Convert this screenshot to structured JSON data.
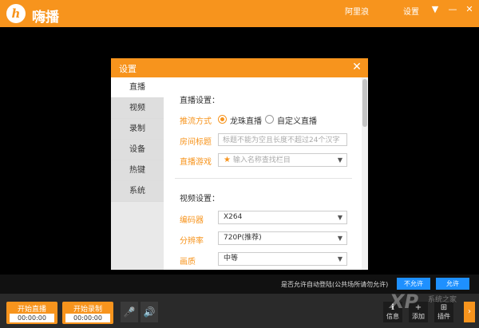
{
  "app": {
    "logo_letter": "h",
    "name": "嗨播"
  },
  "topbar": {
    "user": "阿里浪",
    "settings": "设置",
    "menu_icon": "▼",
    "min_icon": "—",
    "close_icon": "✕"
  },
  "dialog": {
    "title": "设置",
    "close_icon": "✕",
    "nav": [
      "直播",
      "视频",
      "录制",
      "设备",
      "热键",
      "系统"
    ],
    "live_section": "直播设置：",
    "push_label": "推流方式",
    "push_opt1": "龙珠直播",
    "push_opt2": "自定义直播",
    "room_label": "房间标题",
    "room_placeholder": "标题不能为空且长度不超过24个汉字",
    "game_label": "直播游戏",
    "game_placeholder": "输入名称查找栏目",
    "video_section": "视频设置：",
    "encoder_label": "编码器",
    "encoder_value": "X264",
    "res_label": "分辨率",
    "res_value": "720P(推荐)",
    "quality_label": "画质",
    "quality_value": "中等",
    "arrow": "▼"
  },
  "allow": {
    "text": "是否允许自动登陆(公共场所请勿允许)",
    "deny": "不允许",
    "allow": "允许"
  },
  "bottom": {
    "start_live": "开始直播",
    "live_time": "00:00:00",
    "start_record": "开始录制",
    "record_time": "00:00:00",
    "mic_icon": "🎤",
    "speaker_icon": "🔊",
    "tools": [
      {
        "icon": "ℹ",
        "label": "信息"
      },
      {
        "icon": "+",
        "label": "添加"
      },
      {
        "icon": "⊞",
        "label": "插件"
      }
    ],
    "watermark": "XP",
    "watermark_sub": "系统之家",
    "side_arrow": "›"
  },
  "colors": {
    "accent": "#f7941d",
    "blue": "#1e90ff"
  }
}
